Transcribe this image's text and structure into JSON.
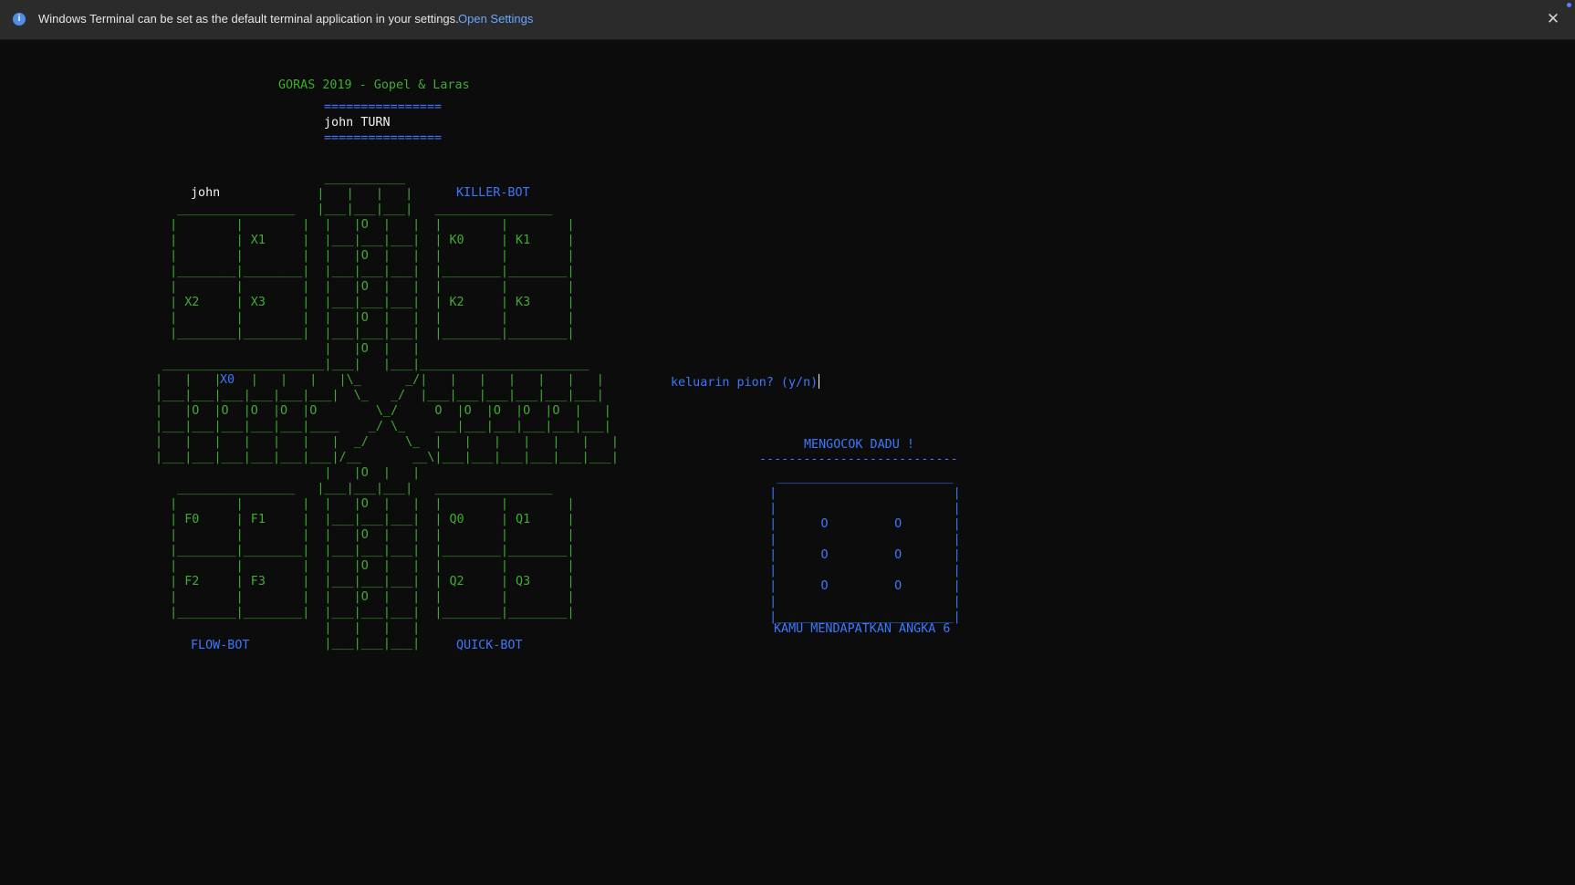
{
  "banner": {
    "message": "Windows Terminal can be set as the default terminal application in your settings.",
    "link_label": "Open Settings",
    "info_icon": "info-icon",
    "close_icon": "close-icon"
  },
  "colors": {
    "background": "#0c0c0c",
    "green": "#3fae2f",
    "blue": "#3b78ff",
    "white": "#f0f0f0",
    "banner_bg": "#2b2b2b",
    "link": "#6aa8ff"
  },
  "terminal": {
    "title": "GORAS 2019 - Gopel & Laras",
    "turn_rule": "================",
    "turn_text": "john TURN",
    "board": {
      "player_top_left": "john",
      "player_top_right": "KILLER-BOT",
      "player_bottom_left": "FLOW-BOT",
      "player_bottom_right": "QUICK-BOT",
      "piece_x0": "X0",
      "lines": [
        "                       ___________",
        "                      |   |   |   |",
        "   ________________   |___|___|___|   ________________",
        "  |        |        |  |   |O  |   |  |        |        |",
        "  |        | X1     |  |___|___|___|  | K0     | K1     |",
        "  |        |        |  |   |O  |   |  |        |        |",
        "  |________|________|  |___|___|___|  |________|________|",
        "  |        |        |  |   |O  |   |  |        |        |",
        "  | X2     | X3     |  |___|___|___|  | K2     | K3     |",
        "  |        |        |  |   |O  |   |  |        |        |",
        "  |________|________|  |___|___|___|  |________|________|",
        "                       |   |O  |   |",
        " ______________________|___|   |___|_______________________",
        "|   |   |    |   |   |   |\\_      _/|   |   |   |   |   |   |",
        "|___|___|___|___|___|___|  \\_   _/  |___|___|___|___|___|___|",
        "|   |O  |O  |O  |O  |O        \\_/     O  |O  |O  |O  |O  |   |",
        "|___|___|___|___|___|____    _/ \\_    ___|___|___|___|___|___|",
        "|   |   |   |   |   |   |  _/     \\_  |   |   |   |   |   |   |",
        "|___|___|___|___|___|___|/__       __\\|___|___|___|___|___|___|",
        "                       |   |O  |   |",
        "   ________________   |___|___|___|   ________________",
        "  |        |        |  |   |O  |   |  |        |        |",
        "  | F0     | F1     |  |___|___|___|  | Q0     | Q1     |",
        "  |        |        |  |   |O  |   |  |        |        |",
        "  |________|________|  |___|___|___|  |________|________|",
        "  |        |        |  |   |O  |   |  |        |        |",
        "  | F2     | F3     |  |___|___|___|  | Q2     | Q3     |",
        "  |        |        |  |   |O  |   |  |        |        |",
        "  |________|________|  |___|___|___|  |________|________|",
        "                       |   |   |   |",
        "                       |___|___|___|"
      ]
    },
    "prompt": "keluarin pion? (y/n)",
    "dice": {
      "header": "MENGOCOK DADU !",
      "rule": "---------------------------",
      "lines": [
        "   ________________________",
        "  |                        |",
        "  |                        |",
        "  |      O         O       |",
        "  |                        |",
        "  |      O         O       |",
        "  |                        |",
        "  |      O         O       |",
        "  |                        |",
        "  |________________________|"
      ],
      "result": "KAMU MENDAPATKAN ANGKA 6"
    }
  }
}
